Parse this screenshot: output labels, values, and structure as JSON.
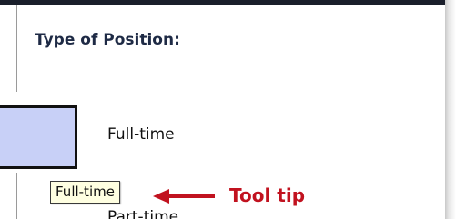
{
  "section": {
    "heading": "Type of Position:"
  },
  "options": [
    {
      "label": "Full-time"
    },
    {
      "label": "Part-time"
    }
  ],
  "tooltip": {
    "text": "Full-time"
  },
  "annotation": {
    "label": "Tool tip",
    "color": "#c1121f"
  },
  "colors": {
    "checkbox_fill": "#c8d0f7",
    "tooltip_bg": "#ffffe1"
  },
  "icons": {
    "annotation_arrow": "left-arrow-icon"
  }
}
